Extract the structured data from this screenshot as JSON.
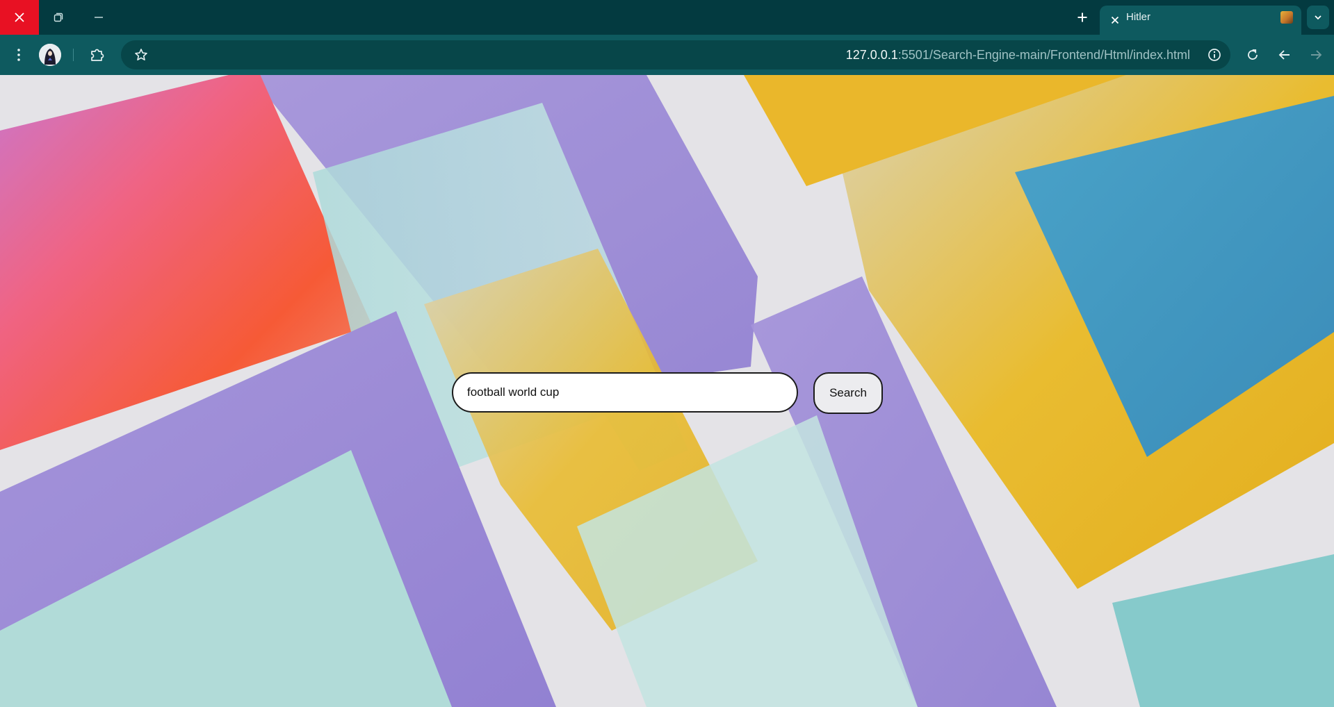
{
  "window_controls": {
    "close_icon": "close-icon",
    "restore_icon": "restore-icon",
    "minimize_icon": "minimize-icon",
    "close_color": "#e81123"
  },
  "tabstrip": {
    "new_tab_icon": "plus-icon",
    "tab_list_icon": "chevron-down-icon",
    "active_tab": {
      "title": "Hitler",
      "close_icon": "close-icon",
      "favicon": "tab-favicon"
    }
  },
  "toolbar": {
    "menu_icon": "kebab-menu-icon",
    "profile_icon": "profile-avatar",
    "extensions_icon": "puzzle-icon",
    "bookmark_icon": "star-icon",
    "url_host": "127.0.0.1",
    "url_path": ":5501/Search-Engine-main/Frontend/Html/index.html",
    "site_info_icon": "info-icon",
    "reload_icon": "reload-icon",
    "back_icon": "back-arrow-icon",
    "forward_icon": "forward-arrow-icon"
  },
  "page": {
    "search": {
      "value": "football world cup",
      "button_label": "Search"
    }
  },
  "theme": {
    "tabstrip_bg": "#033a40",
    "toolbar_bg": "#0e5a5f",
    "omnibox_bg": "#074649"
  }
}
